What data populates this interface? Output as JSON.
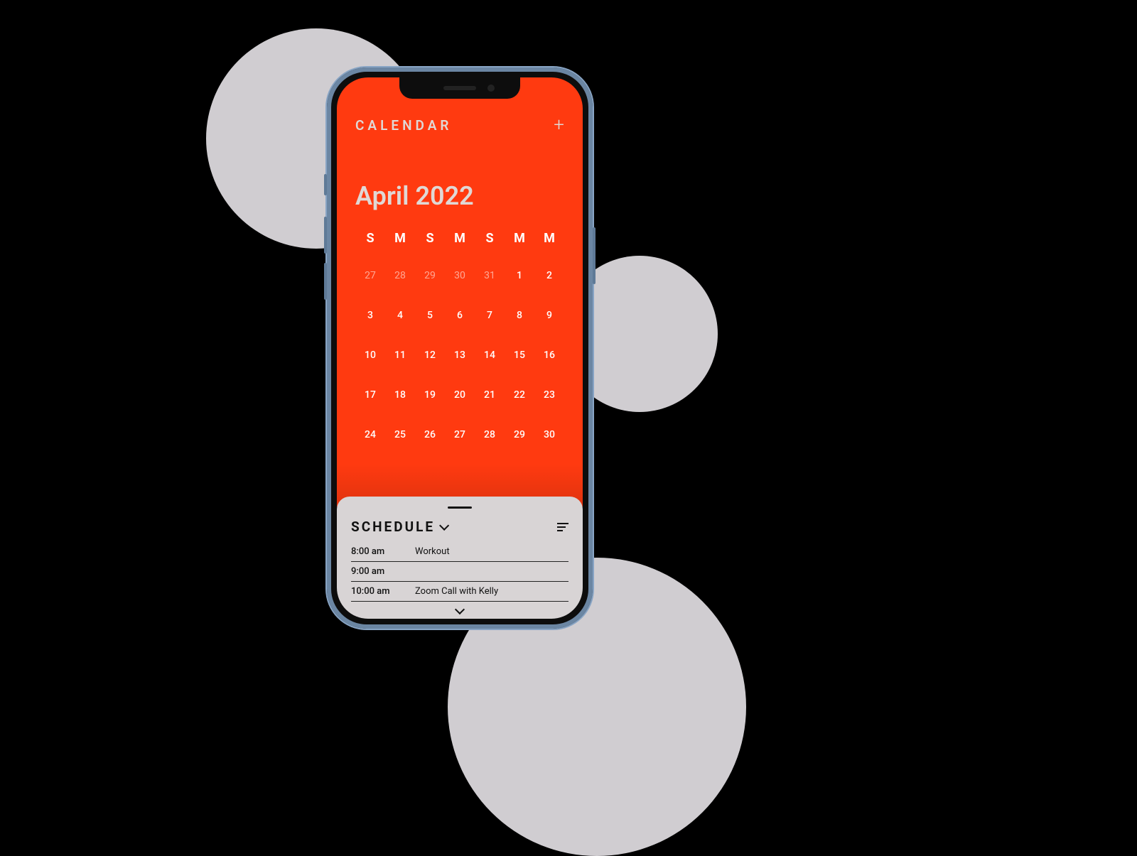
{
  "header": {
    "title": "CALENDAR",
    "month": "April 2022"
  },
  "weekdays": [
    "S",
    "M",
    "S",
    "M",
    "S",
    "M",
    "M"
  ],
  "dates": [
    {
      "n": "27",
      "other": true
    },
    {
      "n": "28",
      "other": true
    },
    {
      "n": "29",
      "other": true
    },
    {
      "n": "30",
      "other": true
    },
    {
      "n": "31",
      "other": true
    },
    {
      "n": "1"
    },
    {
      "n": "2"
    },
    {
      "n": "3"
    },
    {
      "n": "4"
    },
    {
      "n": "5"
    },
    {
      "n": "6"
    },
    {
      "n": "7"
    },
    {
      "n": "8"
    },
    {
      "n": "9"
    },
    {
      "n": "10"
    },
    {
      "n": "11",
      "selected": true
    },
    {
      "n": "12"
    },
    {
      "n": "13"
    },
    {
      "n": "14"
    },
    {
      "n": "15"
    },
    {
      "n": "16"
    },
    {
      "n": "17"
    },
    {
      "n": "18"
    },
    {
      "n": "19"
    },
    {
      "n": "20"
    },
    {
      "n": "21"
    },
    {
      "n": "22"
    },
    {
      "n": "23"
    },
    {
      "n": "24"
    },
    {
      "n": "25"
    },
    {
      "n": "26"
    },
    {
      "n": "27"
    },
    {
      "n": "28"
    },
    {
      "n": "29"
    },
    {
      "n": "30"
    }
  ],
  "schedule": {
    "title": "SCHEDULE",
    "items": [
      {
        "time": "8:00 am",
        "event": "Workout"
      },
      {
        "time": "9:00 am",
        "event": ""
      },
      {
        "time": "10:00 am",
        "event": "Zoom Call with Kelly"
      }
    ]
  },
  "colors": {
    "accent": "#ff3a10",
    "bg": "#000",
    "panel": "#d8d4d5",
    "circle": "#d0cdd1"
  }
}
